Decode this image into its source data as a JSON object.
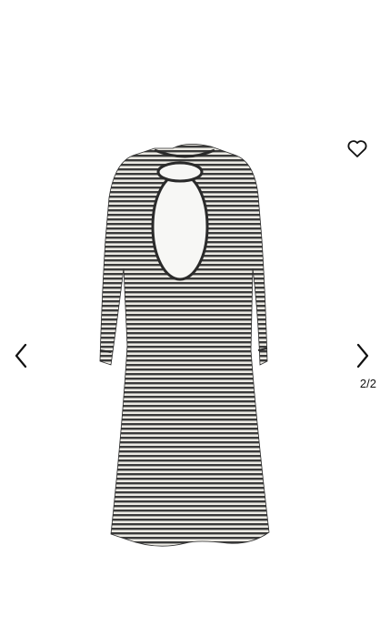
{
  "gallery": {
    "counter": "2/2"
  },
  "colors": {
    "icon": "#111111",
    "dress_dark": "#3a3a3a",
    "dress_light": "#eceae4",
    "background": "#ffffff"
  },
  "icons": {
    "wishlist": "heart-icon",
    "previous": "chevron-left-icon",
    "next": "chevron-right-icon"
  }
}
